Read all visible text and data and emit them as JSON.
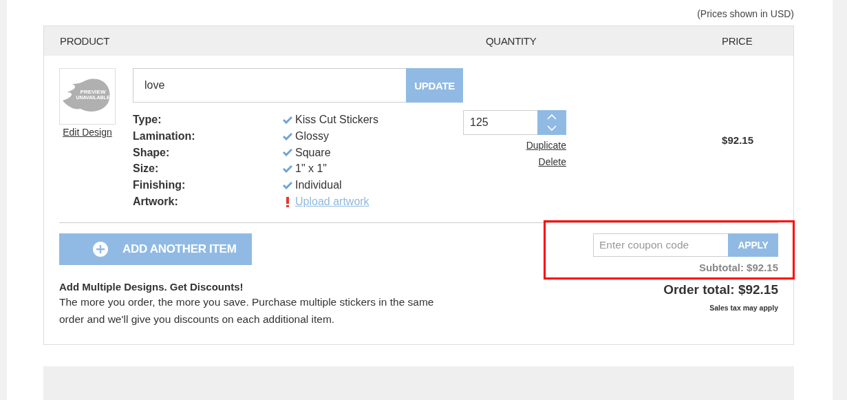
{
  "currency_note": "(Prices shown in USD)",
  "columns": [
    "PRODUCT",
    "QUANTITY",
    "PRICE"
  ],
  "item": {
    "preview_lines": [
      "PREVIEW",
      "UNAVAILABLE"
    ],
    "edit_link": "Edit Design",
    "name": "love",
    "update_button": "UPDATE",
    "options": [
      {
        "label": "Type:",
        "value": "Kiss Cut Stickers",
        "kind": "done"
      },
      {
        "label": "Lamination:",
        "value": "Glossy",
        "kind": "done"
      },
      {
        "label": "Shape:",
        "value": "Square",
        "kind": "done"
      },
      {
        "label": "Size:",
        "value": "1\" x 1\"",
        "kind": "done"
      },
      {
        "label": "Finishing:",
        "value": "Individual",
        "kind": "done"
      },
      {
        "label": "Artwork:",
        "value": "Upload artwork",
        "kind": "missing"
      }
    ],
    "quantity": "125",
    "actions": [
      "Duplicate",
      "Delete"
    ],
    "price": "$92.15"
  },
  "add_button": "ADD ANOTHER ITEM",
  "promo": {
    "title": "Add Multiple Designs. Get Discounts!",
    "text": "The more you order, the more you save. Purchase multiple stickers in the same order and we'll give you discounts on each additional item."
  },
  "coupon": {
    "placeholder": "Enter coupon code",
    "button": "APPLY",
    "subtotal": "Subtotal: $92.15",
    "highlighted": true
  },
  "order_total": "Order total: $92.15",
  "tax_note": "Sales tax may apply"
}
